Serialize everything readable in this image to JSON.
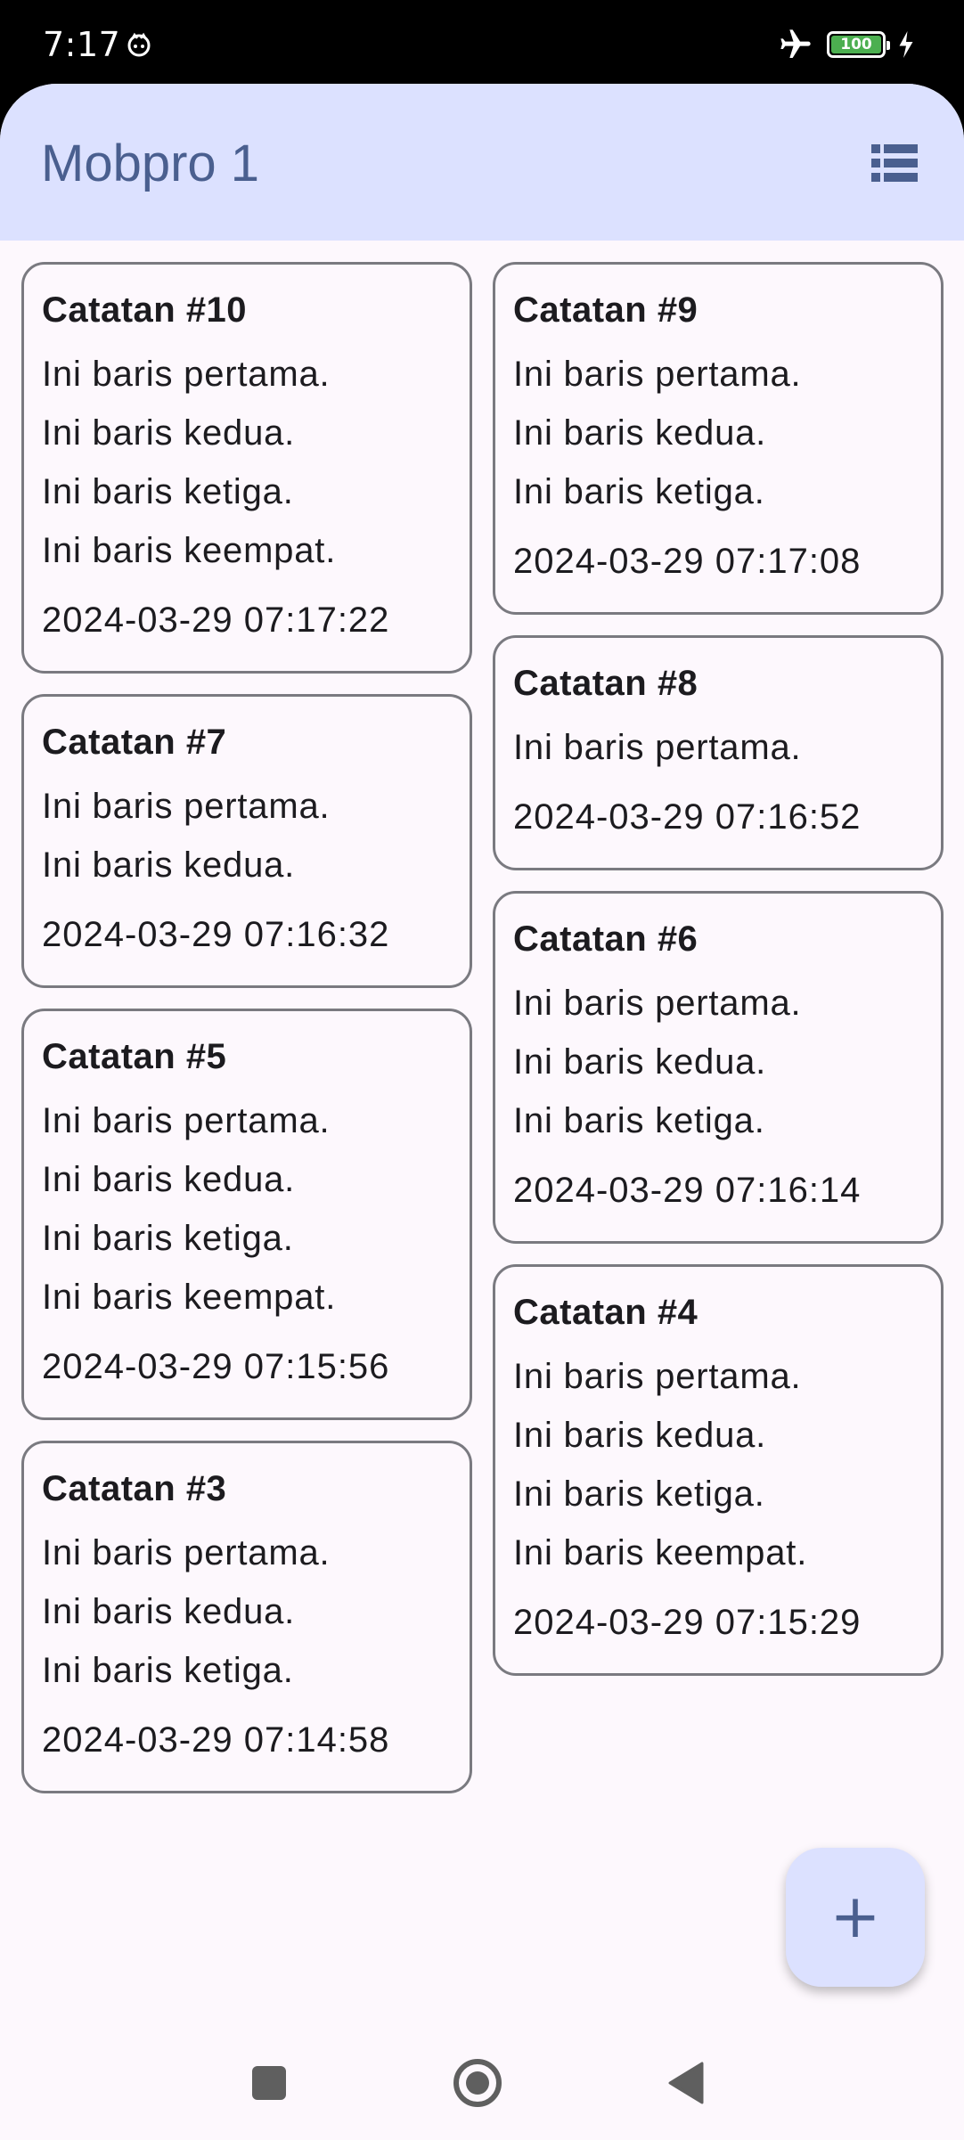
{
  "status": {
    "time": "7:17",
    "battery": "100"
  },
  "app": {
    "title": "Mobpro 1"
  },
  "notes": [
    {
      "title": "Catatan #10",
      "lines": [
        "Ini baris pertama.",
        "Ini baris kedua.",
        "Ini baris ketiga.",
        "Ini baris keempat."
      ],
      "date": "2024-03-29 07:17:22"
    },
    {
      "title": "Catatan #9",
      "lines": [
        "Ini baris pertama.",
        "Ini baris kedua.",
        "Ini baris ketiga."
      ],
      "date": "2024-03-29 07:17:08"
    },
    {
      "title": "Catatan #8",
      "lines": [
        "Ini baris pertama."
      ],
      "date": "2024-03-29 07:16:52"
    },
    {
      "title": "Catatan #7",
      "lines": [
        "Ini baris pertama.",
        "Ini baris kedua."
      ],
      "date": "2024-03-29 07:16:32"
    },
    {
      "title": "Catatan #6",
      "lines": [
        "Ini baris pertama.",
        "Ini baris kedua.",
        "Ini baris ketiga."
      ],
      "date": "2024-03-29 07:16:14"
    },
    {
      "title": "Catatan #5",
      "lines": [
        "Ini baris pertama.",
        "Ini baris kedua.",
        "Ini baris ketiga.",
        "Ini baris keempat."
      ],
      "date": "2024-03-29 07:15:56"
    },
    {
      "title": "Catatan #4",
      "lines": [
        "Ini baris pertama.",
        "Ini baris kedua.",
        "Ini baris ketiga.",
        "Ini baris keempat."
      ],
      "date": "2024-03-29 07:15:29"
    },
    {
      "title": "Catatan #3",
      "lines": [
        "Ini baris pertama.",
        "Ini baris kedua.",
        "Ini baris ketiga."
      ],
      "date": "2024-03-29 07:14:58"
    }
  ],
  "fab": {
    "label": "+",
    "icon": "add-icon"
  },
  "icons": {
    "status": [
      "cat-face-icon",
      "airplane-icon",
      "battery-icon",
      "charging-bolt-icon"
    ],
    "topbar": "list-view-icon",
    "nav": [
      "recents-square-icon",
      "home-circle-icon",
      "back-triangle-icon"
    ]
  },
  "colors": {
    "topbar": "#dce1ff",
    "title": "#4a5f8f",
    "background": "#fdf8fd",
    "card_border": "#7a7a80",
    "battery": "#4caf50"
  }
}
